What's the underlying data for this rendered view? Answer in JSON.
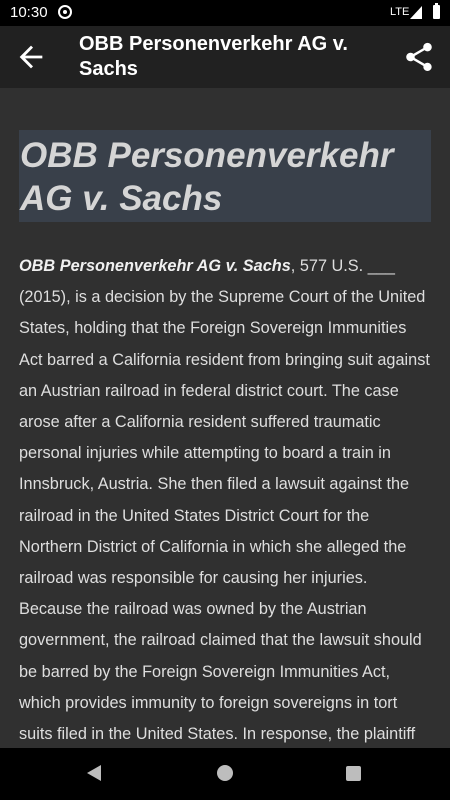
{
  "status_bar": {
    "time": "10:30",
    "network": "LTE",
    "icons": [
      "notification-icon",
      "signal-icon",
      "battery-icon"
    ]
  },
  "app_bar": {
    "title": "OBB Personenverkehr AG v. Sachs",
    "back_icon": "arrow-left-icon",
    "share_icon": "share-icon"
  },
  "article": {
    "title": "OBB Personenverkehr AG v. Sachs",
    "lead": "OBB Personenverkehr AG v. Sachs",
    "body": ", 577 U.S. ___ (2015), is a decision by the Supreme Court of the United States, holding that the Foreign Sovereign Immunities Act barred a California resident from bringing suit against an Austrian railroad in federal district court. The case arose after a California resident suffered traumatic personal injuries while attempting to board a train in Innsbruck, Austria. She then filed a lawsuit against the railroad in the United States District Court for the Northern District of California in which she alleged the railroad was responsible for causing her injuries. Because the railroad was owned by the Austrian government, the railroad claimed that the lawsuit should be barred by the Foreign Sovereign Immunities Act, which provides immunity to foreign sovereigns in tort suits filed in the United States. In response, the plaintiff argued that her suit should be"
  },
  "nav_bar": {
    "icons": [
      "back-triangle-icon",
      "home-circle-icon",
      "recents-square-icon"
    ]
  },
  "colors": {
    "background": "#303030",
    "app_bar": "#212121",
    "title_highlight": "#39404a",
    "text": "#dedede"
  }
}
